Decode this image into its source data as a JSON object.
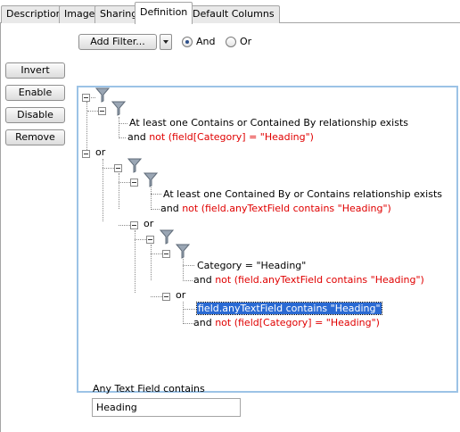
{
  "tabs": [
    {
      "label": "Description"
    },
    {
      "label": "Image"
    },
    {
      "label": "Sharing"
    },
    {
      "label": "Definition"
    },
    {
      "label": "Default Columns"
    }
  ],
  "active_tab": "Definition",
  "toolbar": {
    "add_filter_label": "Add Filter...",
    "radio_and_label": "And",
    "radio_or_label": "Or",
    "selected_operator": "And"
  },
  "side_buttons": {
    "invert": "Invert",
    "enable": "Enable",
    "disable": "Disable",
    "remove": "Remove"
  },
  "tree": {
    "g1_line1": "At least one Contains or Contained By relationship exists",
    "g1_and": "and ",
    "g1_not": "not (field[Category] = \"Heading\")",
    "or1": "or",
    "g2_line1": "At least one Contained By or Contains relationship exists",
    "g2_and": "and ",
    "g2_not": "not (field.anyTextField contains \"Heading\")",
    "or2": "or",
    "g3_line1": "Category = \"Heading\"",
    "g3_and": "and ",
    "g3_not": "not (field.anyTextField contains \"Heading\")",
    "or3": "or",
    "g4_line1": "field.anyTextField contains \"Heading\"",
    "g4_and": "and ",
    "g4_not": "not (field[Category] = \"Heading\")"
  },
  "detail": {
    "label": "Any Text Field contains",
    "value": "Heading"
  },
  "colors": {
    "accent": "#2a6ad3",
    "negation": "#e00000",
    "tree_border": "#9cc3e6",
    "funnel": "#9aa6b4"
  },
  "icons": [
    "filter-funnel-icon",
    "chevron-down-icon",
    "expand-collapse-icon"
  ]
}
